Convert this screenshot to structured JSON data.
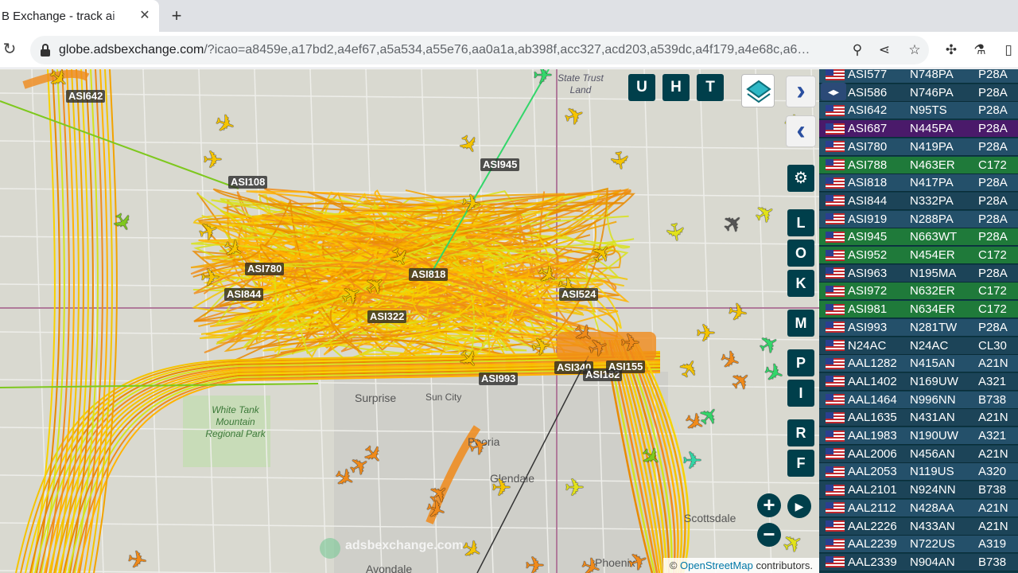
{
  "browser": {
    "tab_title": "B Exchange - track ai",
    "tab_close_icon": "close-icon",
    "new_tab_icon": "plus-icon",
    "url_main": "globe.adsbexchange.com",
    "url_rest": "/?icao=a8459e,a17bd2,a4ef67,a5a534,a55e76,aa0a1a,ab398f,acc327,acd203,a539dc,a4f179,a4e68c,a6…"
  },
  "map": {
    "top_buttons": [
      "U",
      "H",
      "T"
    ],
    "side_buttons": [
      "L",
      "O",
      "K",
      "M",
      "P",
      "I",
      "R",
      "F"
    ],
    "callsigns": [
      {
        "label": "ASI642"
      },
      {
        "label": "ASI108"
      },
      {
        "label": "ASI945"
      },
      {
        "label": "ASI780"
      },
      {
        "label": "ASI844"
      },
      {
        "label": "ASI818"
      },
      {
        "label": "ASI322"
      },
      {
        "label": "ASI524"
      },
      {
        "label": "ASI993"
      },
      {
        "label": "ASI340"
      },
      {
        "label": "ASI182"
      },
      {
        "label": "ASI155"
      }
    ],
    "places": [
      {
        "label": "Surprise"
      },
      {
        "label": "Sun City"
      },
      {
        "label": "Peoria"
      },
      {
        "label": "Glendale"
      },
      {
        "label": "Scottsdale"
      },
      {
        "label": "Avondale"
      },
      {
        "label": "Phoenix"
      }
    ],
    "park_label": "White Tank Mountain Regional Park",
    "land_label": "State Trust Land",
    "watermark": "adsbexchange.com",
    "attribution_prefix": "©",
    "attribution_link": "OpenStreetMap",
    "attribution_suffix": "contributors."
  },
  "aircraft_list": [
    {
      "callsign": "ASI577",
      "reg": "N748PA",
      "type": "P28A",
      "highlight": "normal"
    },
    {
      "callsign": "ASI586",
      "reg": "N746PA",
      "type": "P28A",
      "highlight": "normal"
    },
    {
      "callsign": "ASI642",
      "reg": "N95TS",
      "type": "P28A",
      "highlight": "normal"
    },
    {
      "callsign": "ASI687",
      "reg": "N445PA",
      "type": "P28A",
      "highlight": "selected"
    },
    {
      "callsign": "ASI780",
      "reg": "N419PA",
      "type": "P28A",
      "highlight": "normal"
    },
    {
      "callsign": "ASI788",
      "reg": "N463ER",
      "type": "C172",
      "highlight": "green"
    },
    {
      "callsign": "ASI818",
      "reg": "N417PA",
      "type": "P28A",
      "highlight": "normal"
    },
    {
      "callsign": "ASI844",
      "reg": "N332PA",
      "type": "P28A",
      "highlight": "normal"
    },
    {
      "callsign": "ASI919",
      "reg": "N288PA",
      "type": "P28A",
      "highlight": "normal"
    },
    {
      "callsign": "ASI945",
      "reg": "N663WT",
      "type": "P28A",
      "highlight": "green"
    },
    {
      "callsign": "ASI952",
      "reg": "N454ER",
      "type": "C172",
      "highlight": "green"
    },
    {
      "callsign": "ASI963",
      "reg": "N195MA",
      "type": "P28A",
      "highlight": "normal"
    },
    {
      "callsign": "ASI972",
      "reg": "N632ER",
      "type": "C172",
      "highlight": "green"
    },
    {
      "callsign": "ASI981",
      "reg": "N634ER",
      "type": "C172",
      "highlight": "green"
    },
    {
      "callsign": "ASI993",
      "reg": "N281TW",
      "type": "P28A",
      "highlight": "normal"
    },
    {
      "callsign": "N24AC",
      "reg": "N24AC",
      "type": "CL30",
      "highlight": "normal"
    },
    {
      "callsign": "AAL1282",
      "reg": "N415AN",
      "type": "A21N",
      "highlight": "normal"
    },
    {
      "callsign": "AAL1402",
      "reg": "N169UW",
      "type": "A321",
      "highlight": "normal"
    },
    {
      "callsign": "AAL1464",
      "reg": "N996NN",
      "type": "B738",
      "highlight": "normal"
    },
    {
      "callsign": "AAL1635",
      "reg": "N431AN",
      "type": "A21N",
      "highlight": "normal"
    },
    {
      "callsign": "AAL1983",
      "reg": "N190UW",
      "type": "A321",
      "highlight": "normal"
    },
    {
      "callsign": "AAL2006",
      "reg": "N456AN",
      "type": "A21N",
      "highlight": "normal"
    },
    {
      "callsign": "AAL2053",
      "reg": "N119US",
      "type": "A320",
      "highlight": "normal"
    },
    {
      "callsign": "AAL2101",
      "reg": "N924NN",
      "type": "B738",
      "highlight": "normal"
    },
    {
      "callsign": "AAL2112",
      "reg": "N428AA",
      "type": "A21N",
      "highlight": "normal"
    },
    {
      "callsign": "AAL2226",
      "reg": "N433AN",
      "type": "A21N",
      "highlight": "normal"
    },
    {
      "callsign": "AAL2239",
      "reg": "N722US",
      "type": "A319",
      "highlight": "normal"
    },
    {
      "callsign": "AAL2339",
      "reg": "N904AN",
      "type": "B738",
      "highlight": "normal"
    }
  ],
  "colors": {
    "row_normal": "#24506a",
    "row_alt": "#1c4458",
    "row_green": "#1f7a3a",
    "row_selected": "#4a1a6a",
    "button_bg": "#003f4b"
  }
}
